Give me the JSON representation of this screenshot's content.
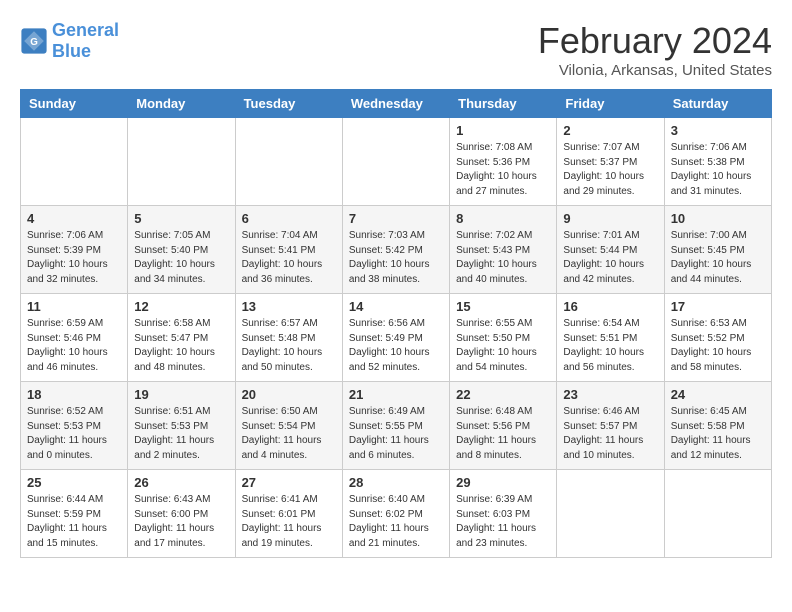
{
  "header": {
    "logo_text_general": "General",
    "logo_text_blue": "Blue",
    "title": "February 2024",
    "subtitle": "Vilonia, Arkansas, United States"
  },
  "weekdays": [
    "Sunday",
    "Monday",
    "Tuesday",
    "Wednesday",
    "Thursday",
    "Friday",
    "Saturday"
  ],
  "weeks": [
    [
      {
        "day": "",
        "info": ""
      },
      {
        "day": "",
        "info": ""
      },
      {
        "day": "",
        "info": ""
      },
      {
        "day": "",
        "info": ""
      },
      {
        "day": "1",
        "info": "Sunrise: 7:08 AM\nSunset: 5:36 PM\nDaylight: 10 hours\nand 27 minutes."
      },
      {
        "day": "2",
        "info": "Sunrise: 7:07 AM\nSunset: 5:37 PM\nDaylight: 10 hours\nand 29 minutes."
      },
      {
        "day": "3",
        "info": "Sunrise: 7:06 AM\nSunset: 5:38 PM\nDaylight: 10 hours\nand 31 minutes."
      }
    ],
    [
      {
        "day": "4",
        "info": "Sunrise: 7:06 AM\nSunset: 5:39 PM\nDaylight: 10 hours\nand 32 minutes."
      },
      {
        "day": "5",
        "info": "Sunrise: 7:05 AM\nSunset: 5:40 PM\nDaylight: 10 hours\nand 34 minutes."
      },
      {
        "day": "6",
        "info": "Sunrise: 7:04 AM\nSunset: 5:41 PM\nDaylight: 10 hours\nand 36 minutes."
      },
      {
        "day": "7",
        "info": "Sunrise: 7:03 AM\nSunset: 5:42 PM\nDaylight: 10 hours\nand 38 minutes."
      },
      {
        "day": "8",
        "info": "Sunrise: 7:02 AM\nSunset: 5:43 PM\nDaylight: 10 hours\nand 40 minutes."
      },
      {
        "day": "9",
        "info": "Sunrise: 7:01 AM\nSunset: 5:44 PM\nDaylight: 10 hours\nand 42 minutes."
      },
      {
        "day": "10",
        "info": "Sunrise: 7:00 AM\nSunset: 5:45 PM\nDaylight: 10 hours\nand 44 minutes."
      }
    ],
    [
      {
        "day": "11",
        "info": "Sunrise: 6:59 AM\nSunset: 5:46 PM\nDaylight: 10 hours\nand 46 minutes."
      },
      {
        "day": "12",
        "info": "Sunrise: 6:58 AM\nSunset: 5:47 PM\nDaylight: 10 hours\nand 48 minutes."
      },
      {
        "day": "13",
        "info": "Sunrise: 6:57 AM\nSunset: 5:48 PM\nDaylight: 10 hours\nand 50 minutes."
      },
      {
        "day": "14",
        "info": "Sunrise: 6:56 AM\nSunset: 5:49 PM\nDaylight: 10 hours\nand 52 minutes."
      },
      {
        "day": "15",
        "info": "Sunrise: 6:55 AM\nSunset: 5:50 PM\nDaylight: 10 hours\nand 54 minutes."
      },
      {
        "day": "16",
        "info": "Sunrise: 6:54 AM\nSunset: 5:51 PM\nDaylight: 10 hours\nand 56 minutes."
      },
      {
        "day": "17",
        "info": "Sunrise: 6:53 AM\nSunset: 5:52 PM\nDaylight: 10 hours\nand 58 minutes."
      }
    ],
    [
      {
        "day": "18",
        "info": "Sunrise: 6:52 AM\nSunset: 5:53 PM\nDaylight: 11 hours\nand 0 minutes."
      },
      {
        "day": "19",
        "info": "Sunrise: 6:51 AM\nSunset: 5:53 PM\nDaylight: 11 hours\nand 2 minutes."
      },
      {
        "day": "20",
        "info": "Sunrise: 6:50 AM\nSunset: 5:54 PM\nDaylight: 11 hours\nand 4 minutes."
      },
      {
        "day": "21",
        "info": "Sunrise: 6:49 AM\nSunset: 5:55 PM\nDaylight: 11 hours\nand 6 minutes."
      },
      {
        "day": "22",
        "info": "Sunrise: 6:48 AM\nSunset: 5:56 PM\nDaylight: 11 hours\nand 8 minutes."
      },
      {
        "day": "23",
        "info": "Sunrise: 6:46 AM\nSunset: 5:57 PM\nDaylight: 11 hours\nand 10 minutes."
      },
      {
        "day": "24",
        "info": "Sunrise: 6:45 AM\nSunset: 5:58 PM\nDaylight: 11 hours\nand 12 minutes."
      }
    ],
    [
      {
        "day": "25",
        "info": "Sunrise: 6:44 AM\nSunset: 5:59 PM\nDaylight: 11 hours\nand 15 minutes."
      },
      {
        "day": "26",
        "info": "Sunrise: 6:43 AM\nSunset: 6:00 PM\nDaylight: 11 hours\nand 17 minutes."
      },
      {
        "day": "27",
        "info": "Sunrise: 6:41 AM\nSunset: 6:01 PM\nDaylight: 11 hours\nand 19 minutes."
      },
      {
        "day": "28",
        "info": "Sunrise: 6:40 AM\nSunset: 6:02 PM\nDaylight: 11 hours\nand 21 minutes."
      },
      {
        "day": "29",
        "info": "Sunrise: 6:39 AM\nSunset: 6:03 PM\nDaylight: 11 hours\nand 23 minutes."
      },
      {
        "day": "",
        "info": ""
      },
      {
        "day": "",
        "info": ""
      }
    ]
  ]
}
